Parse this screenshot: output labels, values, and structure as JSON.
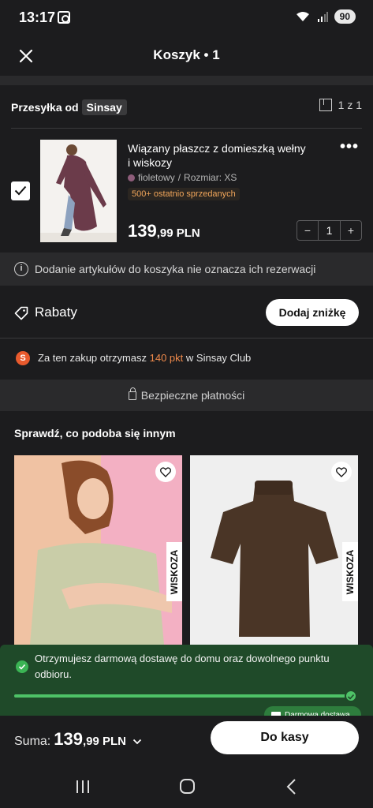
{
  "status": {
    "time": "13:17",
    "battery": "90"
  },
  "header": {
    "title": "Koszyk • 1"
  },
  "shipment": {
    "label": "Przesyłka od",
    "brand": "Sinsay",
    "count": "1 z 1"
  },
  "product": {
    "name": "Wiązany płaszcz z domieszką wełny i wiskozy",
    "color": "fioletowy",
    "size": "Rozmiar: XS",
    "badge": "500+ ostatnio sprzedanych",
    "price_main": "139",
    "price_decimal": ",99 PLN",
    "quantity": "1",
    "minus": "−",
    "plus": "+"
  },
  "info": {
    "text": "Dodanie artykułów do koszyka nie oznacza ich rezerwacji"
  },
  "discounts": {
    "label": "Rabaty",
    "button": "Dodaj zniżkę"
  },
  "club": {
    "prefix": "Za ten zakup otrzymasz",
    "points": "140 pkt",
    "suffix": "w Sinsay Club"
  },
  "secure": {
    "text": "Bezpieczne płatności"
  },
  "recommendations": {
    "title": "Sprawdź, co podoba się innym",
    "cards": [
      {
        "badge": "WISKOZA"
      },
      {
        "badge": "WISKOZA"
      }
    ]
  },
  "delivery_toast": {
    "text": "Otrzymujesz darmową dostawę do domu oraz dowolnego punktu odbioru.",
    "progress": 1.0,
    "badge": "Darmowa dostawa"
  },
  "footer": {
    "sum_label": "Suma:",
    "sum_main": "139",
    "sum_decimal": ",99 PLN",
    "checkout": "Do kasy"
  },
  "colors": {
    "accent_green": "#4ec267",
    "toast_bg": "#1f4a29",
    "points_orange": "#f08a4b"
  }
}
